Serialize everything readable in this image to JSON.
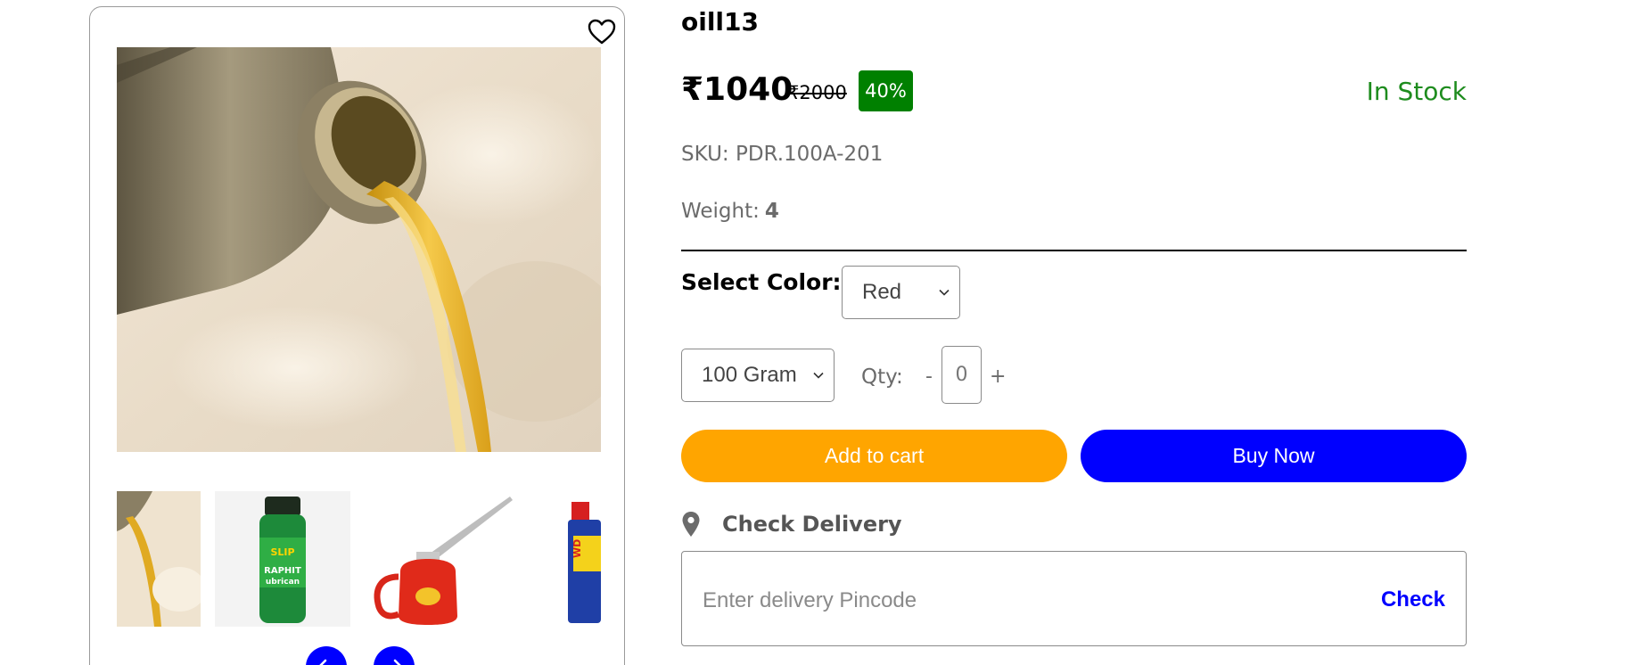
{
  "product": {
    "title": "oill13",
    "price": "₹1040",
    "mrp": "₹2000",
    "discount": "40%",
    "stock_status": "In Stock",
    "sku": "SKU: PDR.100A-201",
    "weight_label": "Weight:",
    "weight_value": "4"
  },
  "options": {
    "color_label": "Select Color:",
    "color_selected": "Red",
    "size_selected": "100 Gram",
    "qty_label": "Qty:",
    "qty_minus": "-",
    "qty_value": "0",
    "qty_plus": "+"
  },
  "actions": {
    "add_to_cart": "Add to cart",
    "buy_now": "Buy Now"
  },
  "delivery": {
    "heading": "Check Delivery",
    "placeholder": "Enter delivery Pincode",
    "check_label": "Check"
  },
  "gallery": {
    "thumbnails": [
      "oil-pour",
      "slip-graphite-lubricant",
      "oil-can",
      "wd-40"
    ]
  },
  "colors": {
    "discount_bg": "#008000",
    "stock_text": "#1e8c1e",
    "add_to_cart_bg": "#ffa500",
    "buy_now_bg": "#0000ff",
    "check_text": "#0000ff"
  },
  "icons": [
    "heart-icon",
    "map-pin-icon",
    "chevron-down-icon",
    "arrow-left-icon",
    "arrow-right-icon"
  ]
}
